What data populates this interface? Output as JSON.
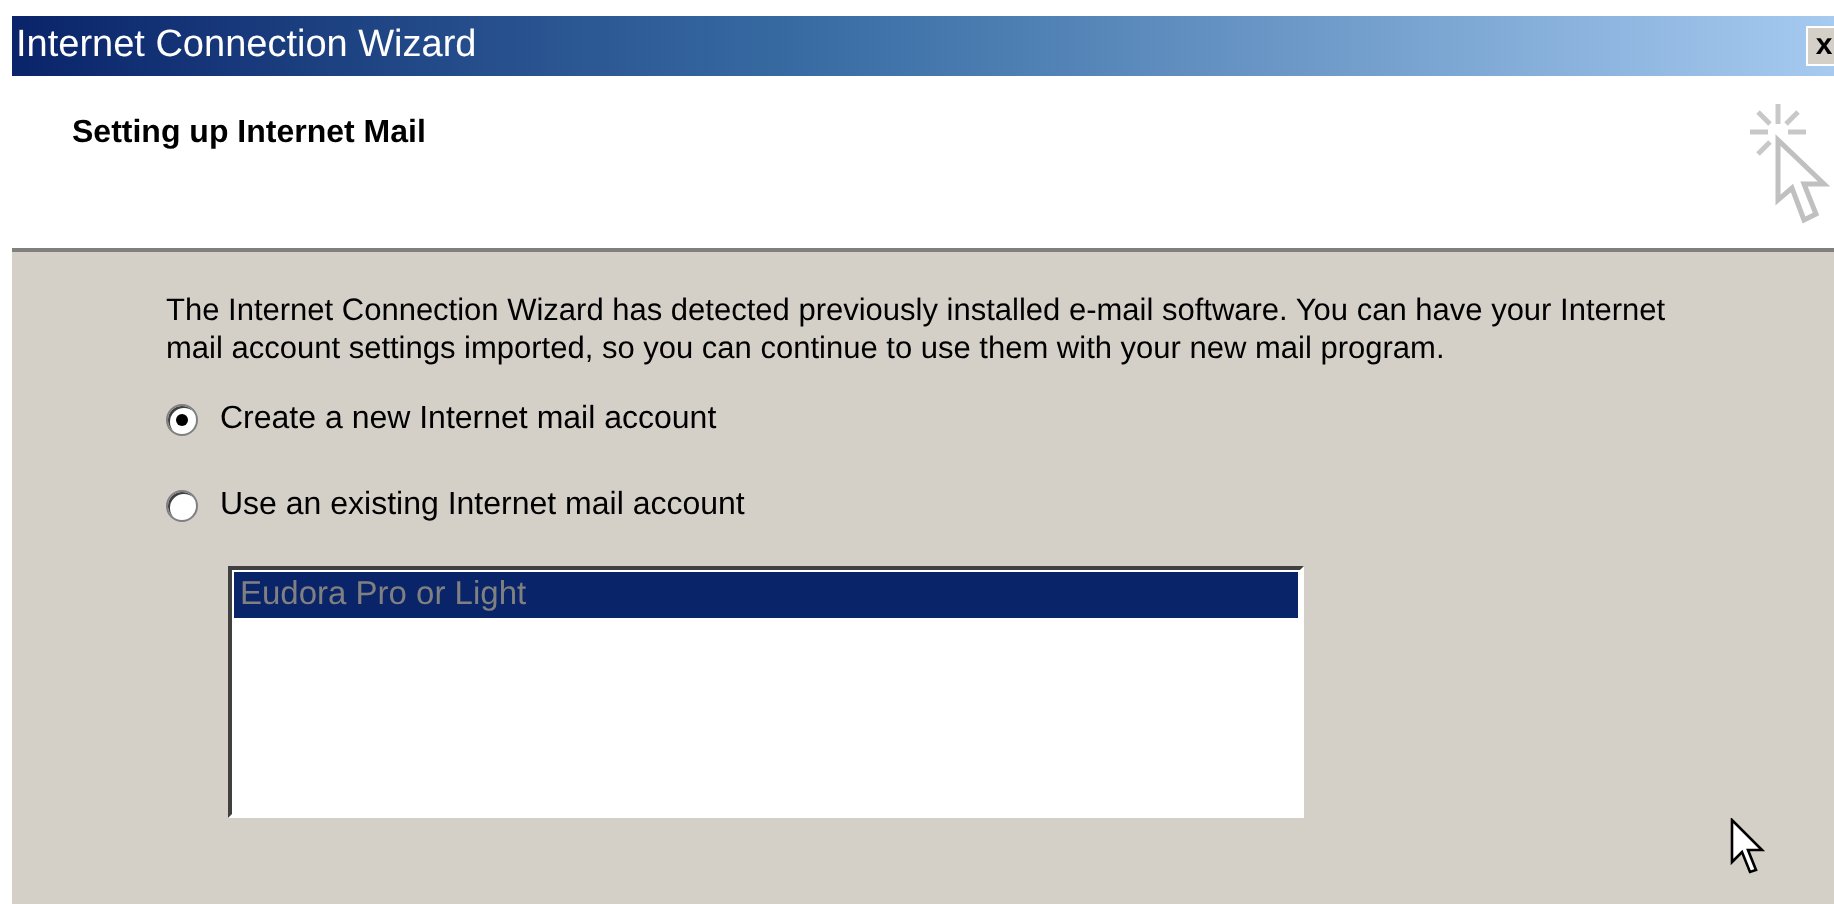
{
  "window": {
    "title": "Internet Connection Wizard",
    "close_button": "x"
  },
  "header": {
    "title": "Setting up Internet Mail"
  },
  "intro": "The Internet Connection Wizard has detected previously installed e-mail software. You can have your Internet mail account settings imported, so you can continue to use them with your new mail program.",
  "options": [
    {
      "label": "Create a new Internet mail account",
      "selected": true
    },
    {
      "label": "Use an existing Internet mail account",
      "selected": false
    }
  ],
  "mail_programs": {
    "disabled": true,
    "items": [
      {
        "label": "Eudora Pro or Light",
        "selected": true
      }
    ]
  }
}
